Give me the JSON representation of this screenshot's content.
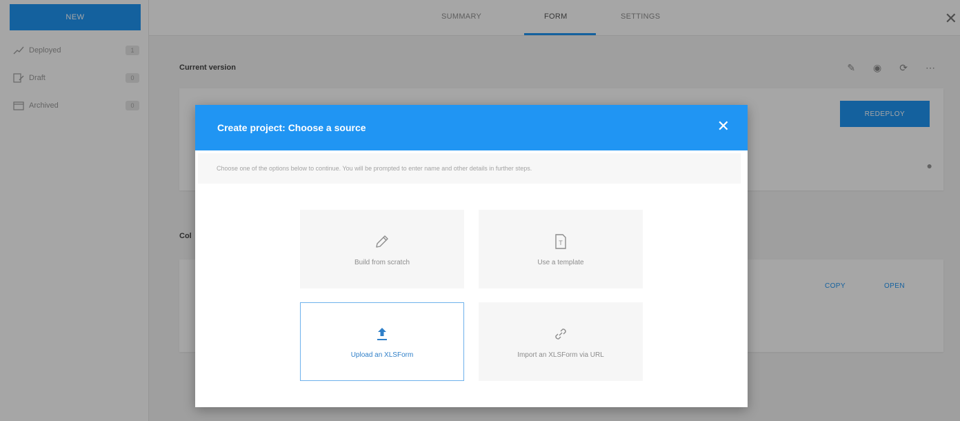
{
  "sidebar": {
    "new_label": "NEW",
    "items": [
      {
        "icon": "deployed-icon",
        "label": "Deployed",
        "count": "1"
      },
      {
        "icon": "draft-icon",
        "label": "Draft",
        "count": "0"
      },
      {
        "icon": "archived-icon",
        "label": "Archived",
        "count": "0"
      }
    ]
  },
  "header": {
    "tabs": [
      "SUMMARY",
      "FORM",
      "SETTINGS"
    ],
    "active_tab": "FORM"
  },
  "main": {
    "current_version_title": "Current version",
    "redeploy_label": "REDEPLOY",
    "collection_title_fragment": "Col",
    "copy_label": "COPY",
    "open_label": "OPEN"
  },
  "modal": {
    "title": "Create project: Choose a source",
    "description": "Choose one of the options below to continue. You will be prompted to enter name and other details in further steps.",
    "options": [
      {
        "label": "Build from scratch",
        "icon": "pencil-icon"
      },
      {
        "label": "Use a template",
        "icon": "template-icon"
      },
      {
        "label": "Upload an XLSForm",
        "icon": "upload-icon",
        "selected": true
      },
      {
        "label": "Import an XLSForm via URL",
        "icon": "link-icon"
      }
    ]
  },
  "colors": {
    "accent": "#2095f3",
    "overlay": "rgba(0,0,0,0.35)"
  }
}
